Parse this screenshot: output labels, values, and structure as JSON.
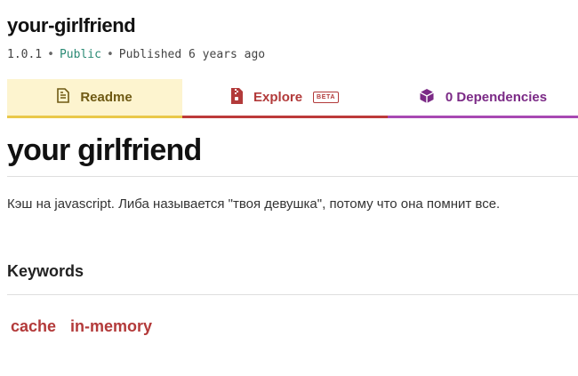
{
  "package": {
    "name": "your-girlfriend",
    "version": "1.0.1",
    "visibility": "Public",
    "published": "Published 6 years ago"
  },
  "tabs": {
    "readme": {
      "label": "Readme",
      "icon": "file-text-icon",
      "color": "#6f5a14"
    },
    "explore": {
      "label": "Explore",
      "badge": "BETA",
      "icon": "file-zip-icon",
      "color": "#b23a3a"
    },
    "dependencies": {
      "label": "0 Dependencies",
      "icon": "box-icon",
      "color": "#7b2a86"
    }
  },
  "readme": {
    "title": "your girlfriend",
    "description": "Кэш на javascript. Либа называется \"твоя девушка\", потому что она помнит все."
  },
  "keywords": {
    "heading": "Keywords",
    "items": [
      "cache",
      "in-memory"
    ]
  },
  "colors": {
    "readme_accent": "#e9c84a",
    "explore_accent": "#bc3a3a",
    "deps_accent": "#a849b3",
    "public": "#2a8a74"
  }
}
